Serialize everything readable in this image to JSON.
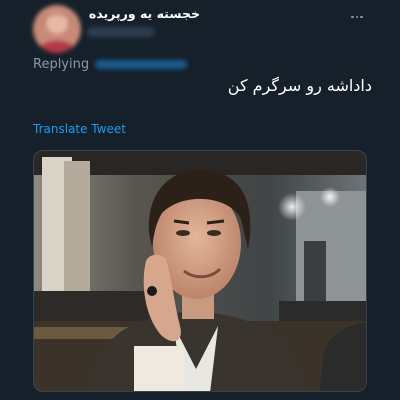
{
  "tweet": {
    "display_name": "خجسته یه ورپریده",
    "replying_label": "Replying",
    "text": "داداشه رو سرگرم کن",
    "translate_label": "Translate Tweet",
    "more_icon": "more-horizontal-icon"
  },
  "colors": {
    "background": "#15202b",
    "text_primary": "#ffffff",
    "text_secondary": "#8899a6",
    "link": "#1d9bf0"
  }
}
